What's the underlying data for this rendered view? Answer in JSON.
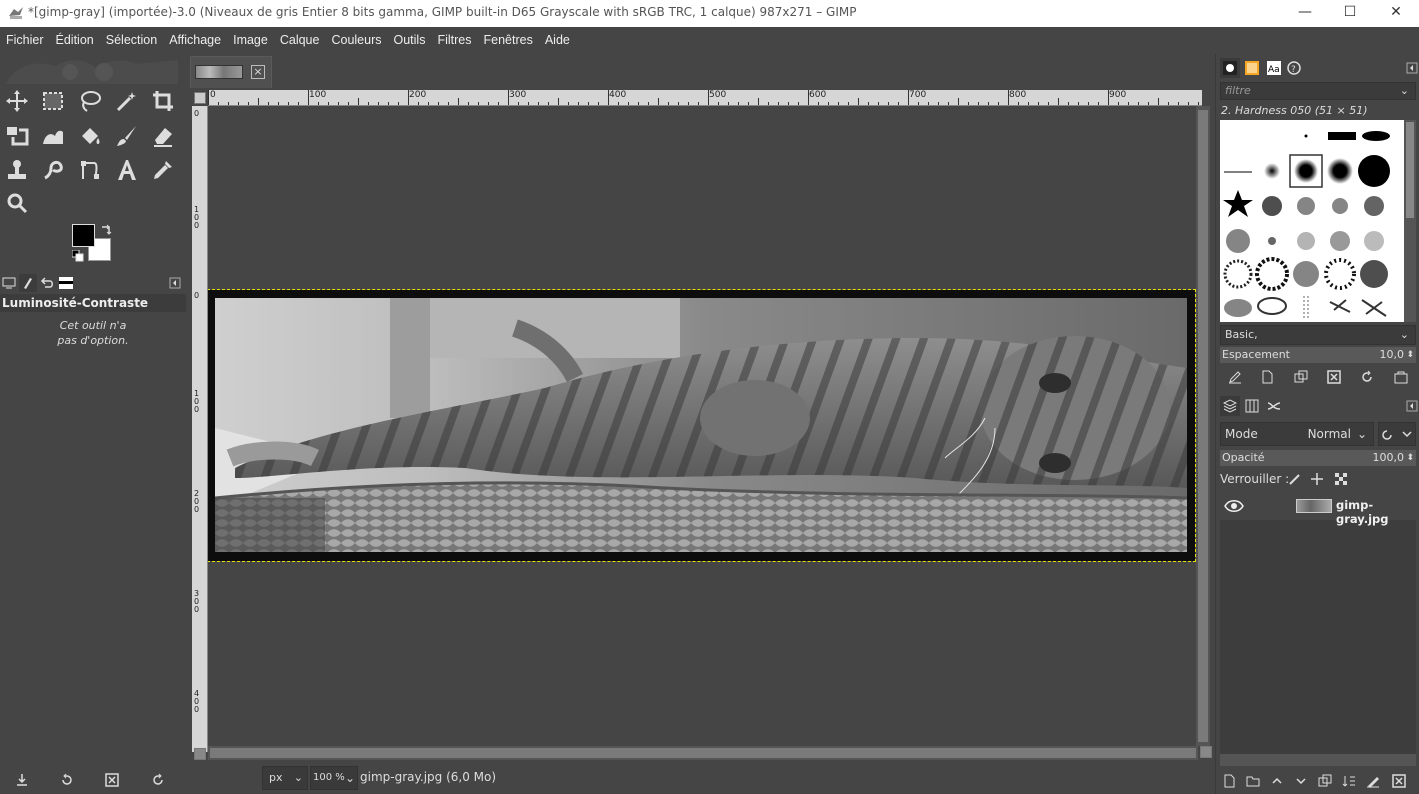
{
  "window": {
    "title": "*[gimp-gray] (importée)-3.0 (Niveaux de gris Entier 8 bits gamma, GIMP built-in D65 Grayscale with sRGB TRC, 1 calque) 987x271 – GIMP",
    "minimize": "—",
    "maximize": "☐",
    "close": "✕"
  },
  "menu": [
    "Fichier",
    "Édition",
    "Sélection",
    "Affichage",
    "Image",
    "Calque",
    "Couleurs",
    "Outils",
    "Filtres",
    "Fenêtres",
    "Aide"
  ],
  "toolbox": {
    "tools": [
      "move-icon",
      "rect-select-icon",
      "lasso-icon",
      "fuzzy-select-icon",
      "crop-icon",
      "transform-icon",
      "warp-icon",
      "bucket-fill-icon",
      "paintbrush-icon",
      "eraser-icon",
      "clone-icon",
      "smudge-icon",
      "paths-icon",
      "text-icon",
      "color-picker-icon",
      "zoom-icon"
    ],
    "fg_color": "#000000",
    "bg_color": "#ffffff",
    "options_title": "Luminosité-Contraste",
    "options_note_1": "Cet outil n'a",
    "options_note_2": "pas d'option."
  },
  "rulers": {
    "h_labels": [
      "0",
      "100",
      "200",
      "300",
      "400",
      "500",
      "600",
      "700",
      "800",
      "900"
    ],
    "v_labels": [
      "0",
      "1 0 0",
      "2 0 0",
      "3 0 0",
      "4 0 0"
    ],
    "v_labels_top": [
      "0",
      "1 0 0"
    ]
  },
  "status": {
    "unit": "px",
    "zoom": "100 %",
    "text": "gimp-gray.jpg (6,0 Mo)"
  },
  "brushes": {
    "filter_placeholder": "filtre",
    "selected": "2. Hardness 050 (51 × 51)",
    "tag": "Basic,",
    "spacing_label": "Espacement",
    "spacing_value": "10,0"
  },
  "layers": {
    "mode_label": "Mode",
    "mode_value": "Normal",
    "opacity_label": "Opacité",
    "opacity_value": "100,0",
    "lock_label": "Verrouiller :",
    "layer_name": "gimp-gray.jpg"
  }
}
